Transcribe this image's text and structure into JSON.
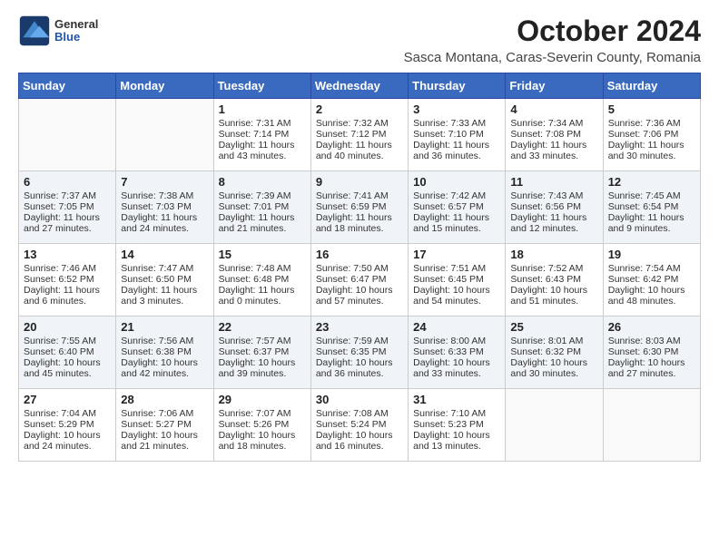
{
  "header": {
    "logo_general": "General",
    "logo_blue": "Blue",
    "title": "October 2024",
    "subtitle": "Sasca Montana, Caras-Severin County, Romania"
  },
  "days_of_week": [
    "Sunday",
    "Monday",
    "Tuesday",
    "Wednesday",
    "Thursday",
    "Friday",
    "Saturday"
  ],
  "weeks": [
    [
      {
        "day": "",
        "sunrise": "",
        "sunset": "",
        "daylight": ""
      },
      {
        "day": "",
        "sunrise": "",
        "sunset": "",
        "daylight": ""
      },
      {
        "day": "1",
        "sunrise": "Sunrise: 7:31 AM",
        "sunset": "Sunset: 7:14 PM",
        "daylight": "Daylight: 11 hours and 43 minutes."
      },
      {
        "day": "2",
        "sunrise": "Sunrise: 7:32 AM",
        "sunset": "Sunset: 7:12 PM",
        "daylight": "Daylight: 11 hours and 40 minutes."
      },
      {
        "day": "3",
        "sunrise": "Sunrise: 7:33 AM",
        "sunset": "Sunset: 7:10 PM",
        "daylight": "Daylight: 11 hours and 36 minutes."
      },
      {
        "day": "4",
        "sunrise": "Sunrise: 7:34 AM",
        "sunset": "Sunset: 7:08 PM",
        "daylight": "Daylight: 11 hours and 33 minutes."
      },
      {
        "day": "5",
        "sunrise": "Sunrise: 7:36 AM",
        "sunset": "Sunset: 7:06 PM",
        "daylight": "Daylight: 11 hours and 30 minutes."
      }
    ],
    [
      {
        "day": "6",
        "sunrise": "Sunrise: 7:37 AM",
        "sunset": "Sunset: 7:05 PM",
        "daylight": "Daylight: 11 hours and 27 minutes."
      },
      {
        "day": "7",
        "sunrise": "Sunrise: 7:38 AM",
        "sunset": "Sunset: 7:03 PM",
        "daylight": "Daylight: 11 hours and 24 minutes."
      },
      {
        "day": "8",
        "sunrise": "Sunrise: 7:39 AM",
        "sunset": "Sunset: 7:01 PM",
        "daylight": "Daylight: 11 hours and 21 minutes."
      },
      {
        "day": "9",
        "sunrise": "Sunrise: 7:41 AM",
        "sunset": "Sunset: 6:59 PM",
        "daylight": "Daylight: 11 hours and 18 minutes."
      },
      {
        "day": "10",
        "sunrise": "Sunrise: 7:42 AM",
        "sunset": "Sunset: 6:57 PM",
        "daylight": "Daylight: 11 hours and 15 minutes."
      },
      {
        "day": "11",
        "sunrise": "Sunrise: 7:43 AM",
        "sunset": "Sunset: 6:56 PM",
        "daylight": "Daylight: 11 hours and 12 minutes."
      },
      {
        "day": "12",
        "sunrise": "Sunrise: 7:45 AM",
        "sunset": "Sunset: 6:54 PM",
        "daylight": "Daylight: 11 hours and 9 minutes."
      }
    ],
    [
      {
        "day": "13",
        "sunrise": "Sunrise: 7:46 AM",
        "sunset": "Sunset: 6:52 PM",
        "daylight": "Daylight: 11 hours and 6 minutes."
      },
      {
        "day": "14",
        "sunrise": "Sunrise: 7:47 AM",
        "sunset": "Sunset: 6:50 PM",
        "daylight": "Daylight: 11 hours and 3 minutes."
      },
      {
        "day": "15",
        "sunrise": "Sunrise: 7:48 AM",
        "sunset": "Sunset: 6:48 PM",
        "daylight": "Daylight: 11 hours and 0 minutes."
      },
      {
        "day": "16",
        "sunrise": "Sunrise: 7:50 AM",
        "sunset": "Sunset: 6:47 PM",
        "daylight": "Daylight: 10 hours and 57 minutes."
      },
      {
        "day": "17",
        "sunrise": "Sunrise: 7:51 AM",
        "sunset": "Sunset: 6:45 PM",
        "daylight": "Daylight: 10 hours and 54 minutes."
      },
      {
        "day": "18",
        "sunrise": "Sunrise: 7:52 AM",
        "sunset": "Sunset: 6:43 PM",
        "daylight": "Daylight: 10 hours and 51 minutes."
      },
      {
        "day": "19",
        "sunrise": "Sunrise: 7:54 AM",
        "sunset": "Sunset: 6:42 PM",
        "daylight": "Daylight: 10 hours and 48 minutes."
      }
    ],
    [
      {
        "day": "20",
        "sunrise": "Sunrise: 7:55 AM",
        "sunset": "Sunset: 6:40 PM",
        "daylight": "Daylight: 10 hours and 45 minutes."
      },
      {
        "day": "21",
        "sunrise": "Sunrise: 7:56 AM",
        "sunset": "Sunset: 6:38 PM",
        "daylight": "Daylight: 10 hours and 42 minutes."
      },
      {
        "day": "22",
        "sunrise": "Sunrise: 7:57 AM",
        "sunset": "Sunset: 6:37 PM",
        "daylight": "Daylight: 10 hours and 39 minutes."
      },
      {
        "day": "23",
        "sunrise": "Sunrise: 7:59 AM",
        "sunset": "Sunset: 6:35 PM",
        "daylight": "Daylight: 10 hours and 36 minutes."
      },
      {
        "day": "24",
        "sunrise": "Sunrise: 8:00 AM",
        "sunset": "Sunset: 6:33 PM",
        "daylight": "Daylight: 10 hours and 33 minutes."
      },
      {
        "day": "25",
        "sunrise": "Sunrise: 8:01 AM",
        "sunset": "Sunset: 6:32 PM",
        "daylight": "Daylight: 10 hours and 30 minutes."
      },
      {
        "day": "26",
        "sunrise": "Sunrise: 8:03 AM",
        "sunset": "Sunset: 6:30 PM",
        "daylight": "Daylight: 10 hours and 27 minutes."
      }
    ],
    [
      {
        "day": "27",
        "sunrise": "Sunrise: 7:04 AM",
        "sunset": "Sunset: 5:29 PM",
        "daylight": "Daylight: 10 hours and 24 minutes."
      },
      {
        "day": "28",
        "sunrise": "Sunrise: 7:06 AM",
        "sunset": "Sunset: 5:27 PM",
        "daylight": "Daylight: 10 hours and 21 minutes."
      },
      {
        "day": "29",
        "sunrise": "Sunrise: 7:07 AM",
        "sunset": "Sunset: 5:26 PM",
        "daylight": "Daylight: 10 hours and 18 minutes."
      },
      {
        "day": "30",
        "sunrise": "Sunrise: 7:08 AM",
        "sunset": "Sunset: 5:24 PM",
        "daylight": "Daylight: 10 hours and 16 minutes."
      },
      {
        "day": "31",
        "sunrise": "Sunrise: 7:10 AM",
        "sunset": "Sunset: 5:23 PM",
        "daylight": "Daylight: 10 hours and 13 minutes."
      },
      {
        "day": "",
        "sunrise": "",
        "sunset": "",
        "daylight": ""
      },
      {
        "day": "",
        "sunrise": "",
        "sunset": "",
        "daylight": ""
      }
    ]
  ]
}
